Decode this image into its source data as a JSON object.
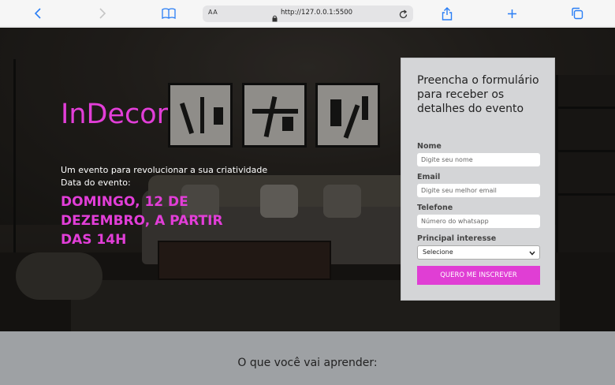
{
  "browser": {
    "address_aa": "AA",
    "url": "http://127.0.0.1:5500"
  },
  "hero": {
    "brand": "InDecor",
    "tagline": "Um evento para revolucionar a sua criatividade",
    "date_label": "Data do evento:",
    "date_value": "DOMINGO, 12 DE DEZEMBRO, A PARTIR DAS 14H"
  },
  "form": {
    "title": "Preencha o formulário para receber os detalhes do evento",
    "name_label": "Nome",
    "name_placeholder": "Digite seu nome",
    "email_label": "Email",
    "email_placeholder": "Digite seu melhor email",
    "phone_label": "Telefone",
    "phone_placeholder": "Número do whatsapp",
    "interest_label": "Principal interesse",
    "interest_selected": "Selecione",
    "submit_label": "QUERO ME INSCREVER"
  },
  "section": {
    "heading": "O que você vai aprender:"
  },
  "colors": {
    "accent": "#e23ed8",
    "form_bg": "#d4d5d7",
    "section_bg": "#9ea1a4",
    "browser_blue": "#2a7ef5"
  }
}
